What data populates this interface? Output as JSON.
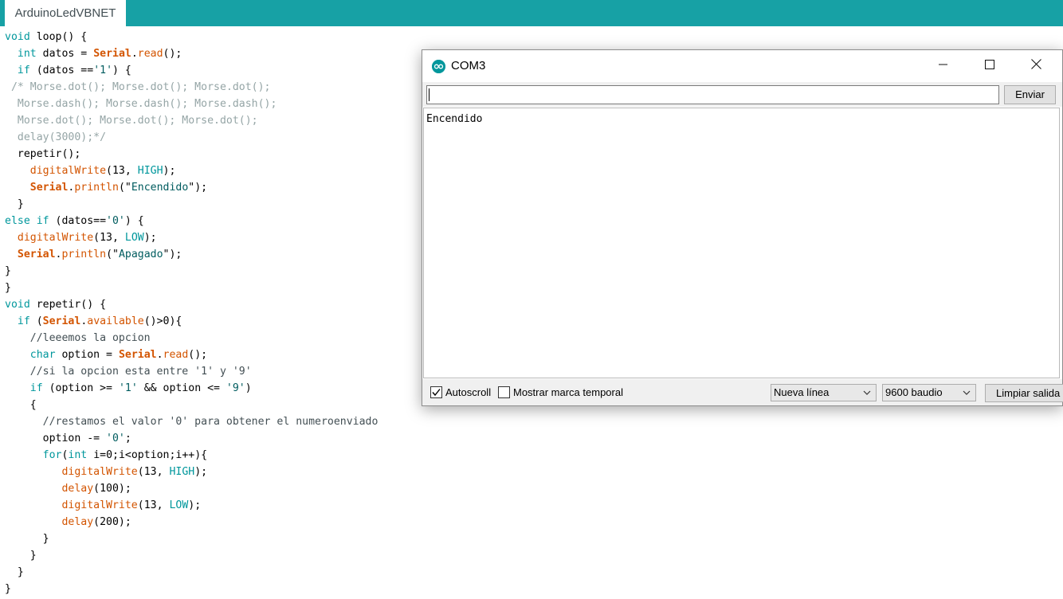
{
  "ide": {
    "tab_label": "ArduinoLedVBNET",
    "code_lines": [
      [
        [
          "t-kw",
          "void "
        ],
        [
          "t-pl",
          "loop() {"
        ]
      ],
      [
        [
          "t-pl",
          "  "
        ],
        [
          "t-kw",
          "int"
        ],
        [
          "t-pl",
          " datos = "
        ],
        [
          "t-ser",
          "Serial"
        ],
        [
          "t-pl",
          "."
        ],
        [
          "t-fn",
          "read"
        ],
        [
          "t-pl",
          "();"
        ]
      ],
      [
        [
          "t-pl",
          "  "
        ],
        [
          "t-kw",
          "if"
        ],
        [
          "t-pl",
          " (datos =="
        ],
        [
          "t-str",
          "'1'"
        ],
        [
          "t-pl",
          ") {"
        ]
      ],
      [
        [
          "t-cm",
          " /* Morse.dot(); Morse.dot(); Morse.dot();"
        ]
      ],
      [
        [
          "t-cm",
          "  Morse.dash(); Morse.dash(); Morse.dash();"
        ]
      ],
      [
        [
          "t-cm",
          "  Morse.dot(); Morse.dot(); Morse.dot();"
        ]
      ],
      [
        [
          "t-cm",
          "  delay(3000);*/"
        ]
      ],
      [
        [
          "t-pl",
          "  repetir();"
        ]
      ],
      [
        [
          "t-pl",
          "    "
        ],
        [
          "t-fn",
          "digitalWrite"
        ],
        [
          "t-pl",
          "(13, "
        ],
        [
          "t-cn",
          "HIGH"
        ],
        [
          "t-pl",
          ");"
        ]
      ],
      [
        [
          "t-pl",
          "    "
        ],
        [
          "t-ser",
          "Serial"
        ],
        [
          "t-pl",
          "."
        ],
        [
          "t-fn",
          "println"
        ],
        [
          "t-pl",
          "(\""
        ],
        [
          "t-str",
          "Encendido"
        ],
        [
          "t-pl",
          "\");"
        ]
      ],
      [
        [
          "t-pl",
          "  }"
        ]
      ],
      [
        [
          "t-kw",
          "else if"
        ],
        [
          "t-pl",
          " (datos=="
        ],
        [
          "t-str",
          "'0'"
        ],
        [
          "t-pl",
          ") {"
        ]
      ],
      [
        [
          "t-pl",
          "  "
        ],
        [
          "t-fn",
          "digitalWrite"
        ],
        [
          "t-pl",
          "(13, "
        ],
        [
          "t-cn",
          "LOW"
        ],
        [
          "t-pl",
          ");"
        ]
      ],
      [
        [
          "t-pl",
          "  "
        ],
        [
          "t-ser",
          "Serial"
        ],
        [
          "t-pl",
          "."
        ],
        [
          "t-fn",
          "println"
        ],
        [
          "t-pl",
          "(\""
        ],
        [
          "t-str",
          "Apagado"
        ],
        [
          "t-pl",
          "\");"
        ]
      ],
      [
        [
          "t-pl",
          "}"
        ]
      ],
      [
        [
          "t-pl",
          "}"
        ]
      ],
      [
        [
          "t-kw",
          "void "
        ],
        [
          "t-pl",
          "repetir() {"
        ]
      ],
      [
        [
          "t-pl",
          "  "
        ],
        [
          "t-kw",
          "if"
        ],
        [
          "t-pl",
          " ("
        ],
        [
          "t-ser",
          "Serial"
        ],
        [
          "t-pl",
          "."
        ],
        [
          "t-fn",
          "available"
        ],
        [
          "t-pl",
          "()>0){"
        ]
      ],
      [
        [
          "t-cm2",
          "    //leeemos la opcion"
        ]
      ],
      [
        [
          "t-pl",
          "    "
        ],
        [
          "t-kw",
          "char"
        ],
        [
          "t-pl",
          " option = "
        ],
        [
          "t-ser",
          "Serial"
        ],
        [
          "t-pl",
          "."
        ],
        [
          "t-fn",
          "read"
        ],
        [
          "t-pl",
          "();"
        ]
      ],
      [
        [
          "t-cm2",
          "    //si la opcion esta entre '1' y '9'"
        ]
      ],
      [
        [
          "t-pl",
          "    "
        ],
        [
          "t-kw",
          "if"
        ],
        [
          "t-pl",
          " (option >= "
        ],
        [
          "t-str",
          "'1'"
        ],
        [
          "t-pl",
          " && option <= "
        ],
        [
          "t-str",
          "'9'"
        ],
        [
          "t-pl",
          ")"
        ]
      ],
      [
        [
          "t-pl",
          "    {"
        ]
      ],
      [
        [
          "t-cm2",
          "      //restamos el valor '0' para obtener el numeroenviado"
        ]
      ],
      [
        [
          "t-pl",
          "      option -= "
        ],
        [
          "t-str",
          "'0'"
        ],
        [
          "t-pl",
          ";"
        ]
      ],
      [
        [
          "t-pl",
          "      "
        ],
        [
          "t-kw",
          "for"
        ],
        [
          "t-pl",
          "("
        ],
        [
          "t-kw",
          "int"
        ],
        [
          "t-pl",
          " i=0;i<option;i++){"
        ]
      ],
      [
        [
          "t-pl",
          "         "
        ],
        [
          "t-fn",
          "digitalWrite"
        ],
        [
          "t-pl",
          "(13, "
        ],
        [
          "t-cn",
          "HIGH"
        ],
        [
          "t-pl",
          ");"
        ]
      ],
      [
        [
          "t-pl",
          "         "
        ],
        [
          "t-fn",
          "delay"
        ],
        [
          "t-pl",
          "(100);"
        ]
      ],
      [
        [
          "t-pl",
          "         "
        ],
        [
          "t-fn",
          "digitalWrite"
        ],
        [
          "t-pl",
          "(13, "
        ],
        [
          "t-cn",
          "LOW"
        ],
        [
          "t-pl",
          ");"
        ]
      ],
      [
        [
          "t-pl",
          "         "
        ],
        [
          "t-fn",
          "delay"
        ],
        [
          "t-pl",
          "(200);"
        ]
      ],
      [
        [
          "t-pl",
          "      }"
        ]
      ],
      [
        [
          "t-pl",
          "    }"
        ]
      ],
      [
        [
          "t-pl",
          "  }"
        ]
      ],
      [
        [
          "t-pl",
          "}"
        ]
      ]
    ]
  },
  "monitor": {
    "title": "COM3",
    "input_value": "",
    "send_label": "Enviar",
    "output_text": "Encendido",
    "autoscroll_label": "Autoscroll",
    "autoscroll_checked": true,
    "timestamp_label": "Mostrar marca temporal",
    "timestamp_checked": false,
    "line_ending_selected": "Nueva línea",
    "baud_selected": "9600 baudio",
    "clear_label": "Limpiar salida"
  },
  "colors": {
    "tabbar": "#17a1a5",
    "keyword": "#00979c",
    "function": "#d35400",
    "string": "#005c5f",
    "comment": "#95a5a6"
  },
  "icons": {
    "app": "arduino-logo-icon",
    "minimize": "minimize-icon",
    "maximize": "maximize-icon",
    "close": "close-icon",
    "dropdown": "chevron-down-icon",
    "check": "checkmark-icon"
  }
}
